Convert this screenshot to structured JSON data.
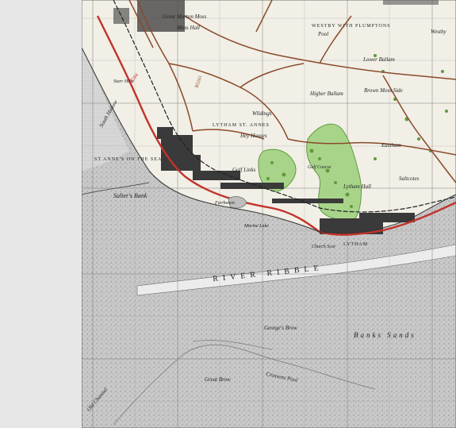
{
  "map": {
    "colors": {
      "land": "#f1efe6",
      "sand": "#cfcfcf",
      "water": "#bdbdbd",
      "grid": "#7a7a7a",
      "road_a": "#c2332a",
      "road_b": "#8a4a2a",
      "rail": "#222222",
      "woodland": "#5e9a3a",
      "golf": "#a8d48a",
      "urban": "#3a3a3a",
      "background": "#e6e6e6"
    },
    "places": {
      "great_marton_moss": "Great Marton Moss",
      "moss_hall": "Moss Hall",
      "westby_with_plumptons": "WESTBY WITH PLUMPTONS",
      "westby": "Westby",
      "pool": "Pool",
      "lower_ballam": "Lower Ballam",
      "higher_ballam": "Higher Ballam",
      "brown_moss_side": "Brown Moss Side",
      "lytham_st_annes": "LYTHAM ST. ANNES",
      "wildings": "Wildings",
      "hey_houses": "Hey Houses",
      "st_annes_on_the_sea": "ST ANNE'S ON THE SEA",
      "golf_links": "Golf Links",
      "golf_course": "Golf Course",
      "lytham_hall": "Lytham Hall",
      "eastham": "Eastham",
      "saltcotes": "Saltcotes",
      "fairhaven": "Fairhaven",
      "lytham": "LYTHAM",
      "church_scar": "Church Scar",
      "starr_hills": "Starr Hills",
      "marine_lake": "Marine Lake"
    },
    "water": {
      "salters_bank": "Salter's Bank",
      "river_ribble": "RIVER RIBBLE",
      "georges_brow": "George's Brow",
      "banks_sands": "Banks Sands",
      "great_brow": "Great Brow",
      "crossens_pool": "Crossens Pool",
      "old_channel": "Old Channel",
      "south_hollow": "South Hollow"
    },
    "roads": {
      "a584": "A584",
      "b5261": "B5261"
    }
  }
}
